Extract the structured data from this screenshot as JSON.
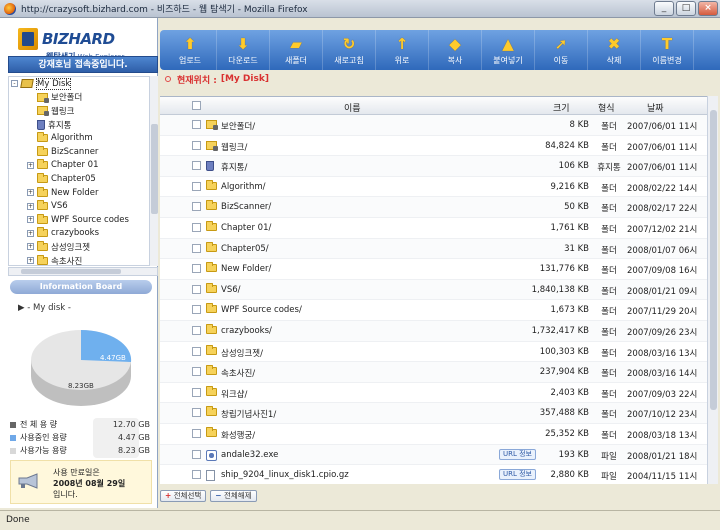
{
  "window": {
    "title": "http://crazysoft.bizhard.com - 비즈하드 - 웹 탐색기 - Mozilla Firefox",
    "status": "Done"
  },
  "app": {
    "logo": "BIZHARD",
    "logo_sub_kr": "웹탐색기",
    "logo_sub_en": "Web Explorer",
    "connect_status": "강재호님 접속중입니다."
  },
  "toolbar": [
    {
      "label": "업로드",
      "icon": "upload-icon",
      "glyph": "⬆"
    },
    {
      "label": "다운로드",
      "icon": "download-icon",
      "glyph": "⬇"
    },
    {
      "label": "새폴더",
      "icon": "new-folder-icon",
      "glyph": "▰"
    },
    {
      "label": "새로고침",
      "icon": "refresh-icon",
      "glyph": "↻"
    },
    {
      "label": "위로",
      "icon": "up-icon",
      "glyph": "↑"
    },
    {
      "label": "복사",
      "icon": "copy-icon",
      "glyph": "◆"
    },
    {
      "label": "붙여넣기",
      "icon": "paste-icon",
      "glyph": "▲"
    },
    {
      "label": "이동",
      "icon": "move-icon",
      "glyph": "➚"
    },
    {
      "label": "삭제",
      "icon": "delete-icon",
      "glyph": "✖"
    },
    {
      "label": "이름변경",
      "icon": "rename-icon",
      "glyph": "T"
    }
  ],
  "location": {
    "label": "현재위치 :",
    "path": "[My Disk]"
  },
  "tree": [
    {
      "label": "My Disk",
      "level": 0,
      "exp": "-",
      "icon": "disk"
    },
    {
      "label": "보안폴더",
      "level": 1,
      "exp": "",
      "icon": "lock"
    },
    {
      "label": "웹링크",
      "level": 1,
      "exp": "",
      "icon": "lock"
    },
    {
      "label": "휴지통",
      "level": 1,
      "exp": "",
      "icon": "trash"
    },
    {
      "label": "Algorithm",
      "level": 1,
      "exp": "",
      "icon": "folder"
    },
    {
      "label": "BizScanner",
      "level": 1,
      "exp": "",
      "icon": "folder"
    },
    {
      "label": "Chapter 01",
      "level": 1,
      "exp": "+",
      "icon": "folder"
    },
    {
      "label": "Chapter05",
      "level": 1,
      "exp": "",
      "icon": "folder"
    },
    {
      "label": "New Folder",
      "level": 1,
      "exp": "+",
      "icon": "folder"
    },
    {
      "label": "VS6",
      "level": 1,
      "exp": "+",
      "icon": "folder"
    },
    {
      "label": "WPF Source codes",
      "level": 1,
      "exp": "+",
      "icon": "folder"
    },
    {
      "label": "crazybooks",
      "level": 1,
      "exp": "+",
      "icon": "folder"
    },
    {
      "label": "삼성잉크젯",
      "level": 1,
      "exp": "+",
      "icon": "folder"
    },
    {
      "label": "속초사진",
      "level": 1,
      "exp": "+",
      "icon": "folder"
    }
  ],
  "info_board": {
    "title": "Information Board",
    "disk_label": "▶ - My disk -",
    "used_label": "4.47GB",
    "free_label": "8.23GB",
    "stats": [
      {
        "label": "전  체  용  량",
        "value": "12.70 GB",
        "color": "#666666"
      },
      {
        "label": "사용중인 용량",
        "value": "4.47 GB",
        "color": "#6fa8e8"
      },
      {
        "label": "사용가능 용량",
        "value": "8.23 GB",
        "color": "#d8d8d8"
      }
    ],
    "expiry_line1": "사용 만료일은",
    "expiry_line2": "2008년 08월 29일",
    "expiry_line3": "입니다."
  },
  "columns": {
    "name": "이름",
    "size": "크기",
    "type": "형식",
    "date": "날짜"
  },
  "files": [
    {
      "name": "보안폴더/",
      "size": "8 KB",
      "type": "폴더",
      "date": "2007/06/01 11시",
      "icon": "lock"
    },
    {
      "name": "웹링크/",
      "size": "84,824 KB",
      "type": "폴더",
      "date": "2007/06/01 11시",
      "icon": "lock"
    },
    {
      "name": "휴지통/",
      "size": "106 KB",
      "type": "휴지통",
      "date": "2007/06/01 11시",
      "icon": "trash"
    },
    {
      "name": "Algorithm/",
      "size": "9,216 KB",
      "type": "폴더",
      "date": "2008/02/22 14시",
      "icon": "folder"
    },
    {
      "name": "BizScanner/",
      "size": "50 KB",
      "type": "폴더",
      "date": "2008/02/17 22시",
      "icon": "folder"
    },
    {
      "name": "Chapter 01/",
      "size": "1,761 KB",
      "type": "폴더",
      "date": "2007/12/02 21시",
      "icon": "folder"
    },
    {
      "name": "Chapter05/",
      "size": "31 KB",
      "type": "폴더",
      "date": "2008/01/07 06시",
      "icon": "folder"
    },
    {
      "name": "New Folder/",
      "size": "131,776 KB",
      "type": "폴더",
      "date": "2007/09/08 16시",
      "icon": "folder"
    },
    {
      "name": "VS6/",
      "size": "1,840,138 KB",
      "type": "폴더",
      "date": "2008/01/21 09시",
      "icon": "folder"
    },
    {
      "name": "WPF Source codes/",
      "size": "1,673 KB",
      "type": "폴더",
      "date": "2007/11/29 20시",
      "icon": "folder"
    },
    {
      "name": "crazybooks/",
      "size": "1,732,417 KB",
      "type": "폴더",
      "date": "2007/09/26 23시",
      "icon": "folder"
    },
    {
      "name": "삼성잉크젯/",
      "size": "100,303 KB",
      "type": "폴더",
      "date": "2008/03/16 13시",
      "icon": "folder"
    },
    {
      "name": "속초사진/",
      "size": "237,904 KB",
      "type": "폴더",
      "date": "2008/03/16 14시",
      "icon": "folder"
    },
    {
      "name": "워크샵/",
      "size": "2,403 KB",
      "type": "폴더",
      "date": "2007/09/03 22시",
      "icon": "folder"
    },
    {
      "name": "창립기념사진1/",
      "size": "357,488 KB",
      "type": "폴더",
      "date": "2007/10/12 23시",
      "icon": "folder"
    },
    {
      "name": "화성행궁/",
      "size": "25,352 KB",
      "type": "폴더",
      "date": "2008/03/18 13시",
      "icon": "folder"
    },
    {
      "name": "andale32.exe",
      "size": "193 KB",
      "type": "파일",
      "date": "2008/01/21 18시",
      "icon": "exe",
      "url": "URL 정보"
    },
    {
      "name": "ship_9204_linux_disk1.cpio.gz",
      "size": "2,880 KB",
      "type": "파일",
      "date": "2004/11/15 11시",
      "icon": "file",
      "url": "URL 정보"
    }
  ],
  "actions": {
    "select_all": "전체선택",
    "deselect_all": "전체해제"
  }
}
